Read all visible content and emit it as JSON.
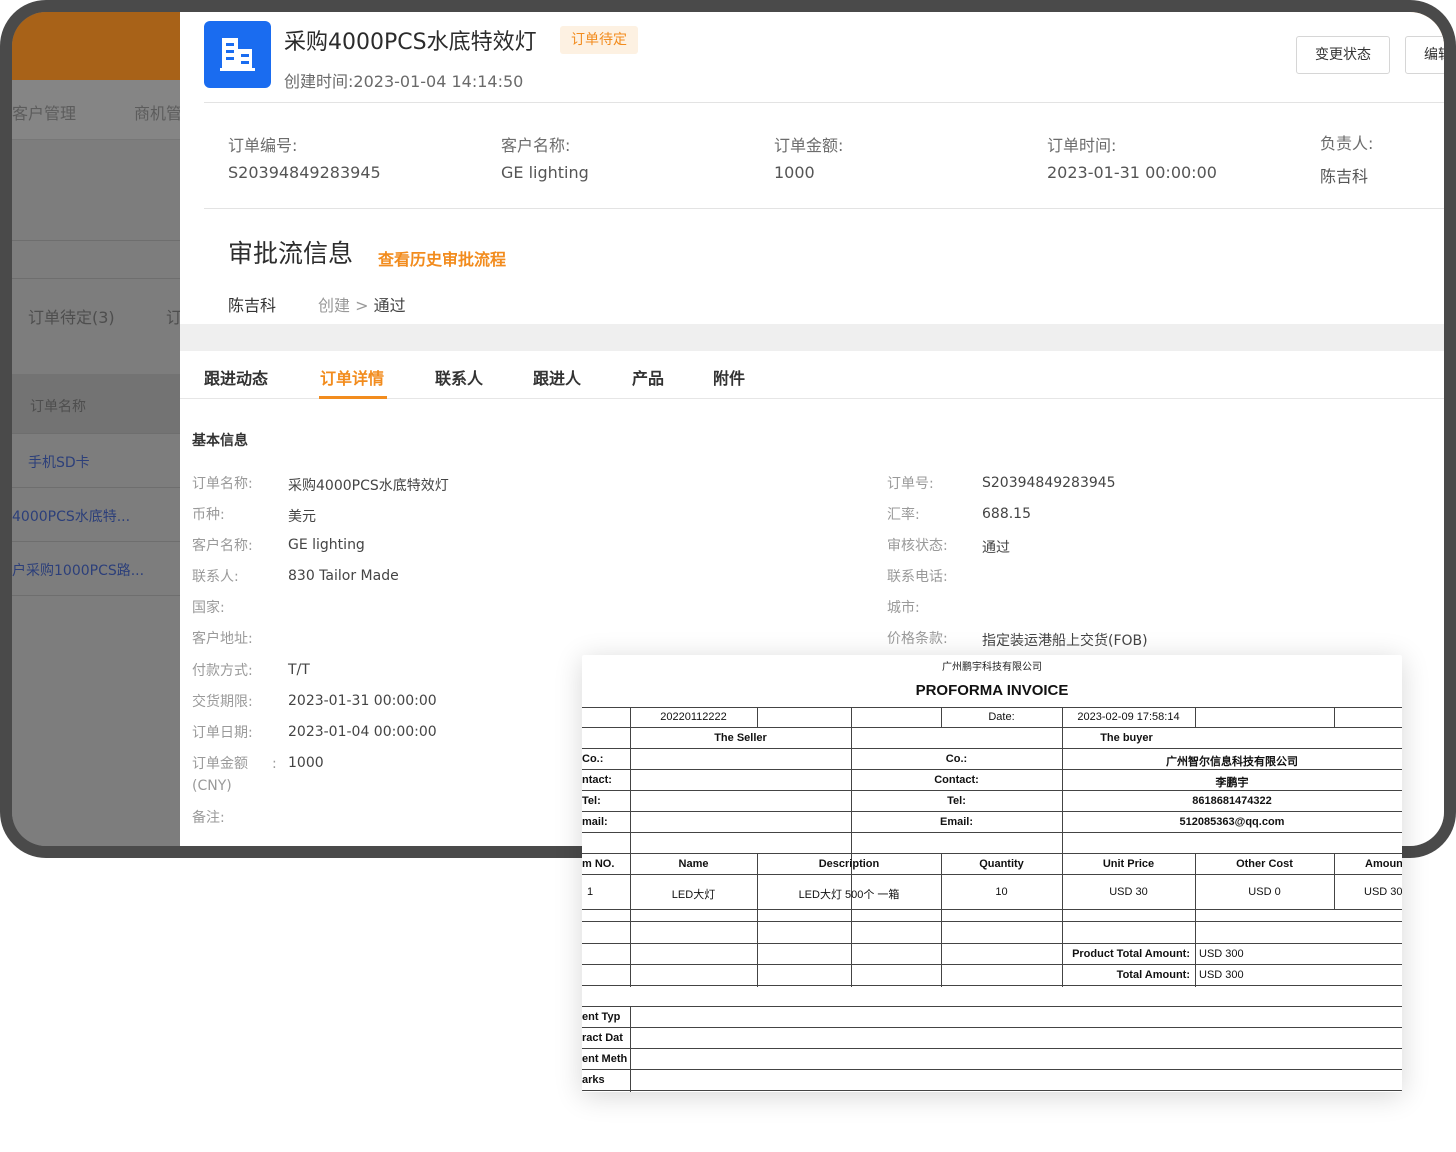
{
  "background": {
    "nav": [
      "客户管理",
      "商机管"
    ],
    "status_tab": "订单待定(3)",
    "status_tab_next": "订",
    "column_header": "订单名称",
    "rows": [
      "手机SD卡",
      "4000PCS水底特...",
      "户采购1000PCS路..."
    ]
  },
  "header": {
    "title": "采购4000PCS水底特效灯",
    "status_badge": "订单待定",
    "created_label": "创建时间:",
    "created_value": "2023-01-04 14:14:50",
    "buttons": [
      "变更状态",
      "编辑"
    ]
  },
  "summary": [
    {
      "label": "订单编号:",
      "value": "S20394849283945"
    },
    {
      "label": "客户名称:",
      "value": "GE lighting"
    },
    {
      "label": "订单金额:",
      "value": "1000"
    },
    {
      "label": "订单时间:",
      "value": "2023-01-31 00:00:00"
    },
    {
      "label": "负责人:",
      "value": "陈吉科"
    }
  ],
  "approval": {
    "title": "审批流信息",
    "history_link": "查看历史审批流程",
    "user": "陈吉科",
    "step_from": "创建",
    "separator": ">",
    "step_to": "通过"
  },
  "tabs": [
    "跟进动态",
    "订单详情",
    "联系人",
    "跟进人",
    "产品",
    "附件"
  ],
  "active_tab": "订单详情",
  "basic_info": {
    "title": "基本信息",
    "left": [
      {
        "label": "订单名称:",
        "value": "采购4000PCS水底特效灯"
      },
      {
        "label": "币种:",
        "value": "美元"
      },
      {
        "label": "客户名称:",
        "value": "GE lighting"
      },
      {
        "label": "联系人:",
        "value": "830 Tailor Made"
      },
      {
        "label": "国家:",
        "value": ""
      },
      {
        "label": "客户地址:",
        "value": ""
      },
      {
        "label": "付款方式:",
        "value": "T/T"
      },
      {
        "label": "交货期限:",
        "value": "2023-01-31 00:00:00"
      },
      {
        "label": "订单日期:",
        "value": "2023-01-04 00:00:00"
      },
      {
        "label": "订单金额",
        "label2": "(CNY)",
        "colon": ":",
        "value": "1000"
      },
      {
        "label": "备注:",
        "value": ""
      }
    ],
    "right": [
      {
        "label": "订单号:",
        "value": "S20394849283945"
      },
      {
        "label": "汇率:",
        "value": "688.15"
      },
      {
        "label": "审核状态:",
        "value": "通过"
      },
      {
        "label": "联系电话:",
        "value": ""
      },
      {
        "label": "城市:",
        "value": ""
      },
      {
        "label": "价格条款:",
        "value": "指定装运港船上交货(FOB)"
      }
    ]
  },
  "invoice": {
    "company": "广州鹏宇科技有限公司",
    "title": "PROFORMA INVOICE",
    "number": "20220112222",
    "date_label": "Date:",
    "date_value": "2023-02-09 17:58:14",
    "seller_header": "The  Seller",
    "buyer_header": "The  buyer",
    "left_labels": [
      "Co.:",
      "ntact:",
      "Tel:",
      "mail:"
    ],
    "buyer_labels": [
      "Co.:",
      "Contact:",
      "Tel:",
      "Email:"
    ],
    "buyer_values": [
      "广州智尔信息科技有限公司",
      "李鹏宇",
      "8618681474322",
      "512085363@qq.com"
    ],
    "item_headers": [
      "m NO.",
      "Name",
      "Description",
      "Quantity",
      "Unit Price",
      "Other Cost",
      "Amoun"
    ],
    "item_row": [
      "1",
      "LED大灯",
      "LED大灯 500个 一箱",
      "10",
      "USD 30",
      "USD  0",
      "USD 30"
    ],
    "product_total_label": "Product Total Amount:",
    "product_total_value": "USD 300",
    "total_label": "Total Amount:",
    "total_value": "USD 300",
    "footer_labels": [
      "ent Typ",
      "ract Dat",
      "ent Meth",
      "arks"
    ]
  }
}
